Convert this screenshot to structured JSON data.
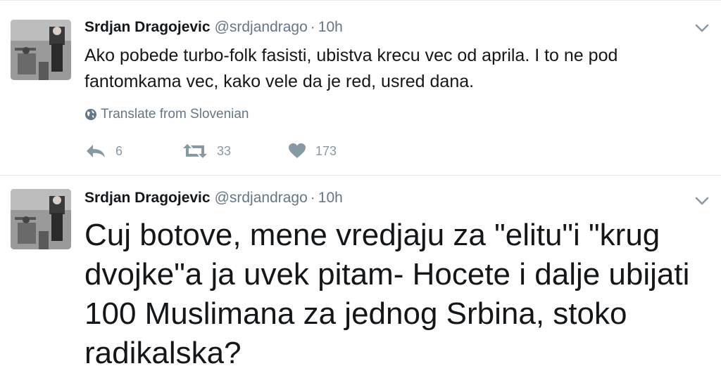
{
  "tweets": [
    {
      "author_name": "Srdjan Dragojevic",
      "handle": "@srdjandrago",
      "separator": "·",
      "time": "10h",
      "text": "Ako pobede turbo-folk fasisti, ubistva krecu vec od aprila. I to ne pod fantomkama vec, kako vele da je red, usred dana.",
      "translate_label": "Translate from Slovenian",
      "reply_count": "6",
      "retweet_count": "33",
      "like_count": "173"
    },
    {
      "author_name": "Srdjan Dragojevic",
      "handle": "@srdjandrago",
      "separator": "·",
      "time": "10h",
      "text": "Cuj botove, mene vredjaju za \"elitu\"i \"krug dvojke\"a ja uvek pitam- Hocete i dalje ubijati 100 Muslimana za jednog Srbina, stoko radikalska?"
    }
  ],
  "icons": {
    "chevron": "chevron-down-icon",
    "globe": "globe-icon",
    "reply": "reply-icon",
    "retweet": "retweet-icon",
    "like": "heart-icon"
  },
  "colors": {
    "text": "#14171a",
    "secondary": "#657786",
    "icon": "#8899a6",
    "divider": "#e6ecf0"
  }
}
